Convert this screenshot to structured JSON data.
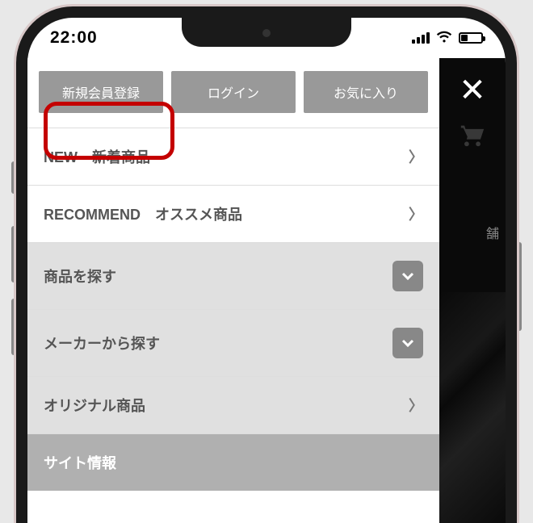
{
  "status": {
    "time": "22:00"
  },
  "topButtons": {
    "register": "新規会員登録",
    "login": "ログイン",
    "favorites": "お気に入り"
  },
  "menu": {
    "newItems": "NEW　新着商品",
    "recommend": "RECOMMEND　オススメ商品",
    "searchProducts": "商品を探す",
    "searchByMaker": "メーカーから探す",
    "original": "オリジナル商品",
    "siteInfo": "サイト情報"
  },
  "rightStrip": {
    "storeLabel": "舗"
  }
}
